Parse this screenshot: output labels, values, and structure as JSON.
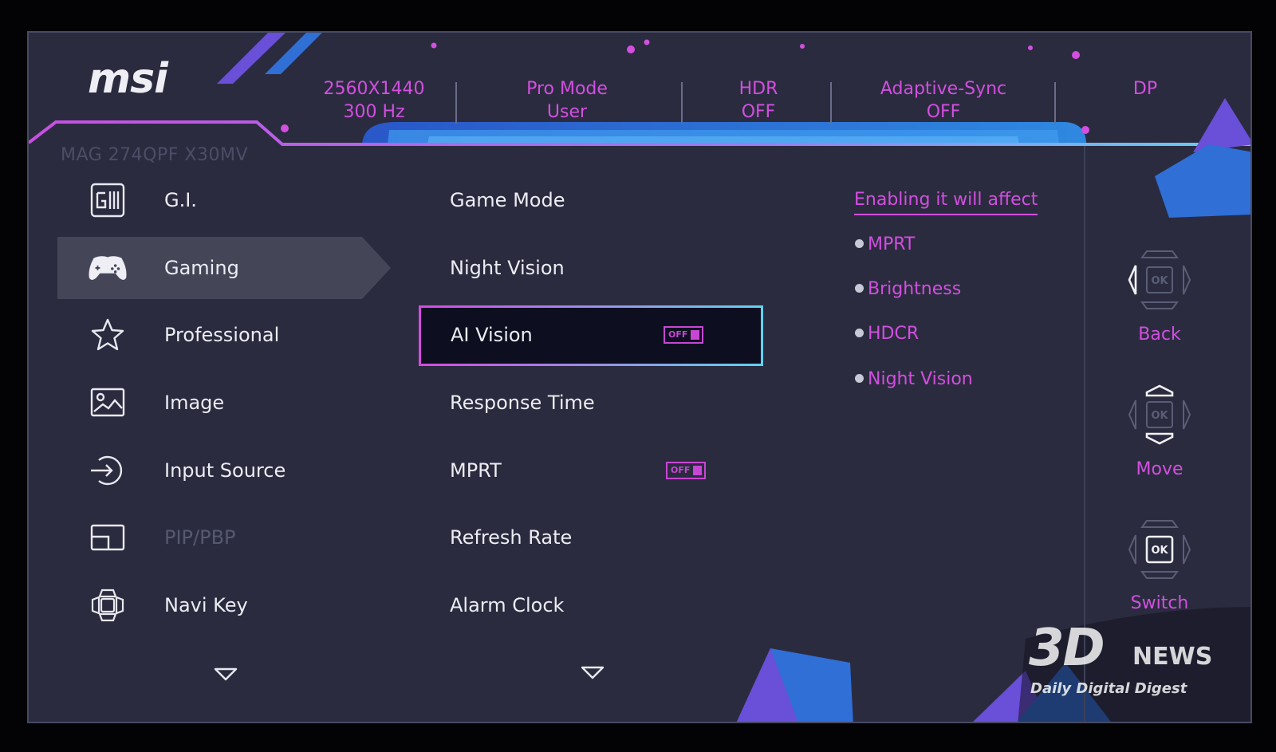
{
  "brand": {
    "logo": "msi"
  },
  "status_bar": [
    {
      "line1": "2560X1440",
      "line2": "300 Hz"
    },
    {
      "line1": "Pro Mode",
      "line2": "User"
    },
    {
      "line1": "HDR",
      "line2": "OFF"
    },
    {
      "line1": "Adaptive-Sync",
      "line2": "OFF"
    },
    {
      "line1": "DP",
      "line2": ""
    }
  ],
  "model_name": "MAG 274QPF X30MV",
  "nav": [
    {
      "label": "G.I.",
      "icon": "gi-icon"
    },
    {
      "label": "Gaming",
      "icon": "gamepad-icon",
      "active": true
    },
    {
      "label": "Professional",
      "icon": "star-icon"
    },
    {
      "label": "Image",
      "icon": "image-icon"
    },
    {
      "label": "Input Source",
      "icon": "input-source-icon"
    },
    {
      "label": "PIP/PBP",
      "icon": "pip-icon",
      "disabled": true
    },
    {
      "label": "Navi Key",
      "icon": "navi-key-icon"
    }
  ],
  "submenu": [
    {
      "label": "Game Mode"
    },
    {
      "label": "Night Vision"
    },
    {
      "label": "AI Vision",
      "toggle": "OFF",
      "selected": true
    },
    {
      "label": "Response Time"
    },
    {
      "label": "MPRT",
      "toggle": "OFF"
    },
    {
      "label": "Refresh Rate"
    },
    {
      "label": "Alarm Clock"
    }
  ],
  "info": {
    "title": "Enabling it will affect",
    "items": [
      "MPRT",
      "Brightness",
      "HDCR",
      "Night Vision"
    ]
  },
  "keys": [
    {
      "label": "Back",
      "center": "OK"
    },
    {
      "label": "Move",
      "center": "OK"
    },
    {
      "label": "Switch",
      "center": "OK"
    }
  ],
  "watermark": {
    "big": "3D",
    "word": "NEWS",
    "tagline": "Daily Digital Digest"
  },
  "colors": {
    "accent": "#d24fe0",
    "panel": "#2b2b3f",
    "cyan": "#5fd2f2",
    "blue": "#2f6fd6"
  }
}
